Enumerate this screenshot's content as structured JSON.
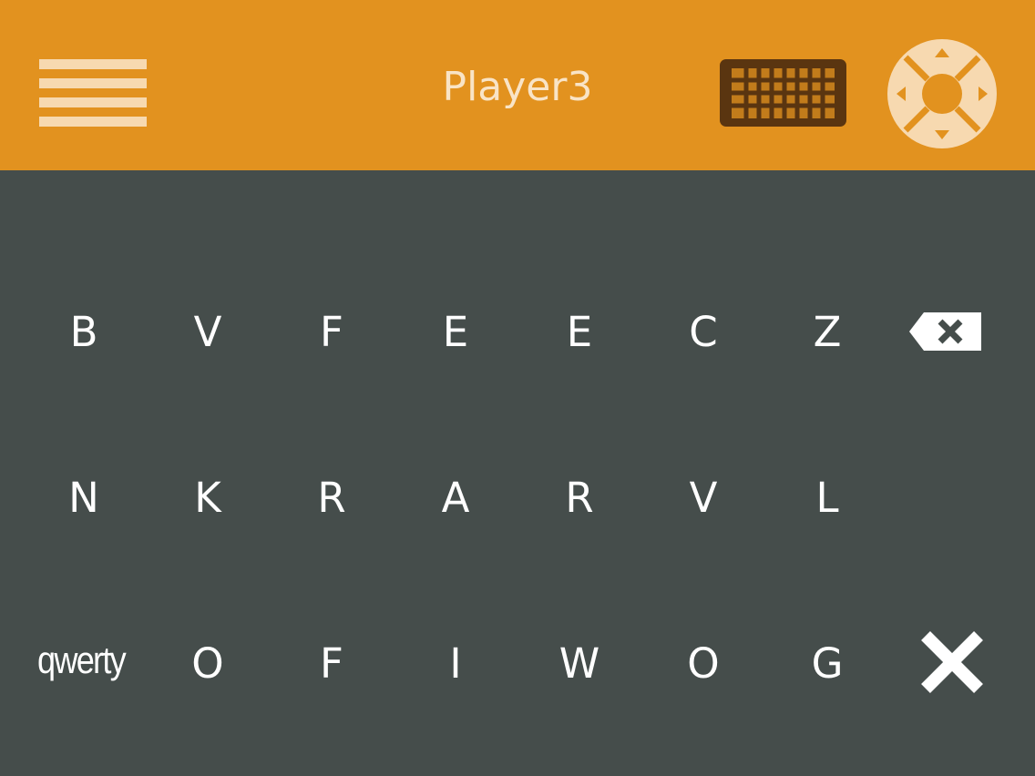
{
  "header": {
    "title": "Player3",
    "menu_icon": "hamburger-menu-icon",
    "keyboard_icon": "keyboard-icon",
    "dpad_icon": "dpad-remote-icon"
  },
  "keyboard": {
    "rows": [
      [
        "B",
        "V",
        "F",
        "E",
        "E",
        "C",
        "Z"
      ],
      [
        "N",
        "K",
        "R",
        "A",
        "R",
        "V",
        "L"
      ],
      [
        "O",
        "F",
        "I",
        "W",
        "O",
        "G"
      ]
    ],
    "layout_toggle_label": "qwerty",
    "backspace_icon": "backspace-icon",
    "close_icon": "close-icon"
  },
  "colors": {
    "header_bg": "#e2921f",
    "body_bg": "#454d4b",
    "header_icon": "#f7d9b0",
    "keyboard_icon_fill": "#5a3510",
    "key_text": "#ffffff"
  }
}
